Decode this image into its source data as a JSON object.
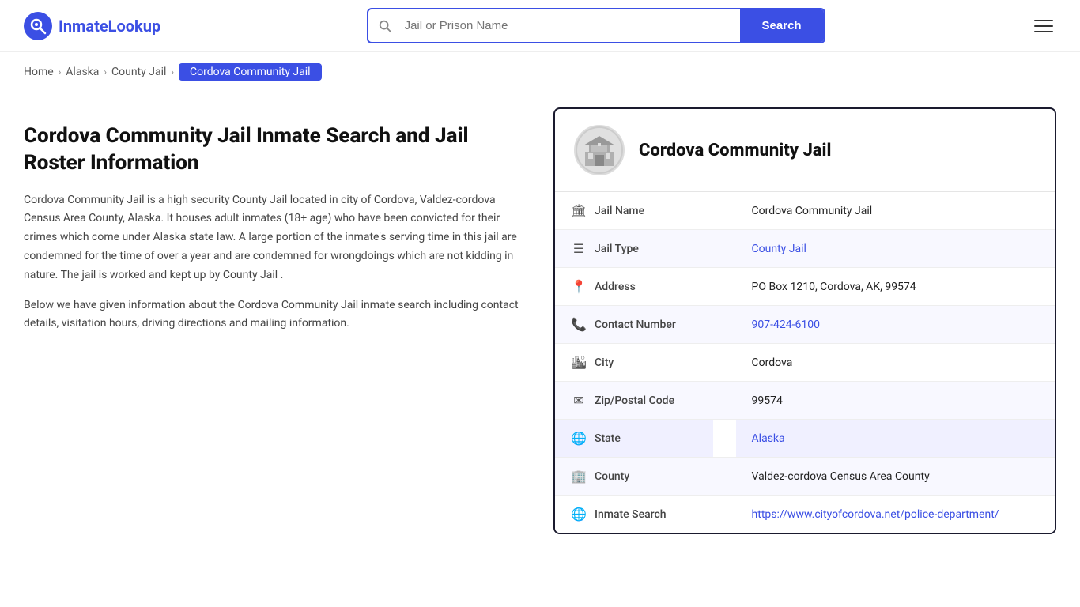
{
  "header": {
    "logo_text_main": "Inmate",
    "logo_text_accent": "Lookup",
    "search_placeholder": "Jail or Prison Name",
    "search_button_label": "Search"
  },
  "breadcrumb": {
    "items": [
      {
        "label": "Home",
        "href": "#"
      },
      {
        "label": "Alaska",
        "href": "#"
      },
      {
        "label": "County Jail",
        "href": "#"
      }
    ],
    "current": "Cordova Community Jail"
  },
  "left": {
    "heading": "Cordova Community Jail Inmate Search and Jail Roster Information",
    "para1": "Cordova Community Jail is a high security County Jail located in city of Cordova, Valdez-cordova Census Area County, Alaska. It houses adult inmates (18+ age) who have been convicted for their crimes which come under Alaska state law. A large portion of the inmate's serving time in this jail are condemned for the time of over a year and are condemned for wrongdoings which are not kidding in nature. The jail is worked and kept up by County Jail .",
    "para2": "Below we have given information about the Cordova Community Jail inmate search including contact details, visitation hours, driving directions and mailing information."
  },
  "card": {
    "title": "Cordova Community Jail",
    "rows": [
      {
        "icon": "🏛",
        "label": "Jail Name",
        "value": "Cordova Community Jail",
        "link": null,
        "highlight": false
      },
      {
        "icon": "☰",
        "label": "Jail Type",
        "value": "County Jail",
        "link": "#",
        "highlight": false
      },
      {
        "icon": "📍",
        "label": "Address",
        "value": "PO Box 1210, Cordova, AK, 99574",
        "link": null,
        "highlight": false
      },
      {
        "icon": "📞",
        "label": "Contact Number",
        "value": "907-424-6100",
        "link": "tel:907-424-6100",
        "highlight": false
      },
      {
        "icon": "🏙",
        "label": "City",
        "value": "Cordova",
        "link": null,
        "highlight": false
      },
      {
        "icon": "✉",
        "label": "Zip/Postal Code",
        "value": "99574",
        "link": null,
        "highlight": false
      },
      {
        "icon": "🌐",
        "label": "State",
        "value": "Alaska",
        "link": "#",
        "highlight": true
      },
      {
        "icon": "🏢",
        "label": "County",
        "value": "Valdez-cordova Census Area County",
        "link": null,
        "highlight": false
      },
      {
        "icon": "🌐",
        "label": "Inmate Search",
        "value": "https://www.cityofcordova.net/police-department/",
        "link": "https://www.cityofcordova.net/police-department/",
        "highlight": false
      }
    ]
  }
}
